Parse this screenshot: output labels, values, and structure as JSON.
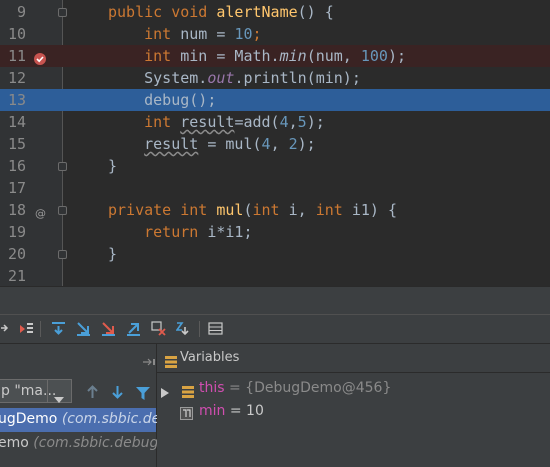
{
  "editor": {
    "lines": [
      {
        "num": "9",
        "kind": "plain",
        "tokens": [
          [
            "public void ",
            "kw"
          ],
          [
            "alertName",
            "fn"
          ],
          [
            "() {",
            ""
          ]
        ]
      },
      {
        "num": "10",
        "kind": "plain",
        "tokens": [
          [
            "    int ",
            "kw"
          ],
          [
            "num = ",
            ""
          ],
          [
            "10",
            "num"
          ],
          [
            ";",
            "kw"
          ]
        ]
      },
      {
        "num": "11",
        "kind": "breakpoint",
        "tokens": [
          [
            "    int ",
            "kw"
          ],
          [
            "min = Math.",
            ""
          ],
          [
            "min",
            "it"
          ],
          [
            "(num, ",
            ""
          ],
          [
            "100",
            "num"
          ],
          [
            ");",
            ""
          ]
        ]
      },
      {
        "num": "12",
        "kind": "plain",
        "tokens": [
          [
            "    System.",
            ""
          ],
          [
            "out",
            "fld it"
          ],
          [
            ".println(min);",
            ""
          ]
        ]
      },
      {
        "num": "13",
        "kind": "current",
        "tokens": [
          [
            "    debug();",
            ""
          ]
        ]
      },
      {
        "num": "14",
        "kind": "plain",
        "tokens": [
          [
            "    int ",
            "kw"
          ],
          [
            "result",
            "wavy"
          ],
          [
            "=add(",
            ""
          ],
          [
            "4",
            "num"
          ],
          [
            ",",
            ""
          ],
          [
            "5",
            "num"
          ],
          [
            ");",
            ""
          ]
        ]
      },
      {
        "num": "15",
        "kind": "plain",
        "tokens": [
          [
            "    ",
            ""
          ],
          [
            "result",
            "wavy"
          ],
          [
            " = mul(",
            ""
          ],
          [
            "4",
            "num"
          ],
          [
            ", ",
            ""
          ],
          [
            "2",
            "num"
          ],
          [
            ");",
            ""
          ]
        ]
      },
      {
        "num": "16",
        "kind": "plain",
        "tokens": [
          [
            "}",
            ""
          ]
        ]
      },
      {
        "num": "17",
        "kind": "plain",
        "tokens": []
      },
      {
        "num": "18",
        "kind": "annot",
        "tokens": [
          [
            "private int ",
            "kw"
          ],
          [
            "mul",
            "fn"
          ],
          [
            "(",
            ""
          ],
          [
            "int ",
            "kw"
          ],
          [
            "i, ",
            ""
          ],
          [
            "int ",
            "kw"
          ],
          [
            "i1) {",
            ""
          ]
        ]
      },
      {
        "num": "19",
        "kind": "plain",
        "tokens": [
          [
            "    return ",
            "kw"
          ],
          [
            "i*i1;",
            ""
          ]
        ]
      },
      {
        "num": "20",
        "kind": "plain",
        "tokens": [
          [
            "}",
            ""
          ]
        ]
      },
      {
        "num": "21",
        "kind": "plain",
        "tokens": []
      }
    ]
  },
  "frames": {
    "dropdown_value": "p \"ma...",
    "items": [
      {
        "name": "ugDemo",
        "pkg": "(com.sbbic.de"
      },
      {
        "name": "emo",
        "pkg": "(com.sbbic.debug)"
      }
    ]
  },
  "variables": {
    "title": "Variables",
    "items": [
      {
        "name": "this",
        "value": "= {DebugDemo@456}",
        "expandable": true
      },
      {
        "name": "min",
        "value": "= 10",
        "expandable": false
      }
    ]
  },
  "colors": {
    "current_line": "#2d5e99",
    "breakpoint": "#c75450",
    "keyword": "#cc7832",
    "number": "#6897bb"
  },
  "icons": [
    "breakpoint-icon",
    "annotation-icon",
    "step-over-icon",
    "step-into-icon",
    "force-step-into-icon",
    "step-out-icon",
    "drop-frame-icon",
    "run-to-cursor-icon",
    "evaluate-icon",
    "restore-layout-icon",
    "up-arrow-icon",
    "down-arrow-icon",
    "filter-icon",
    "expand-icon",
    "field-icon"
  ]
}
